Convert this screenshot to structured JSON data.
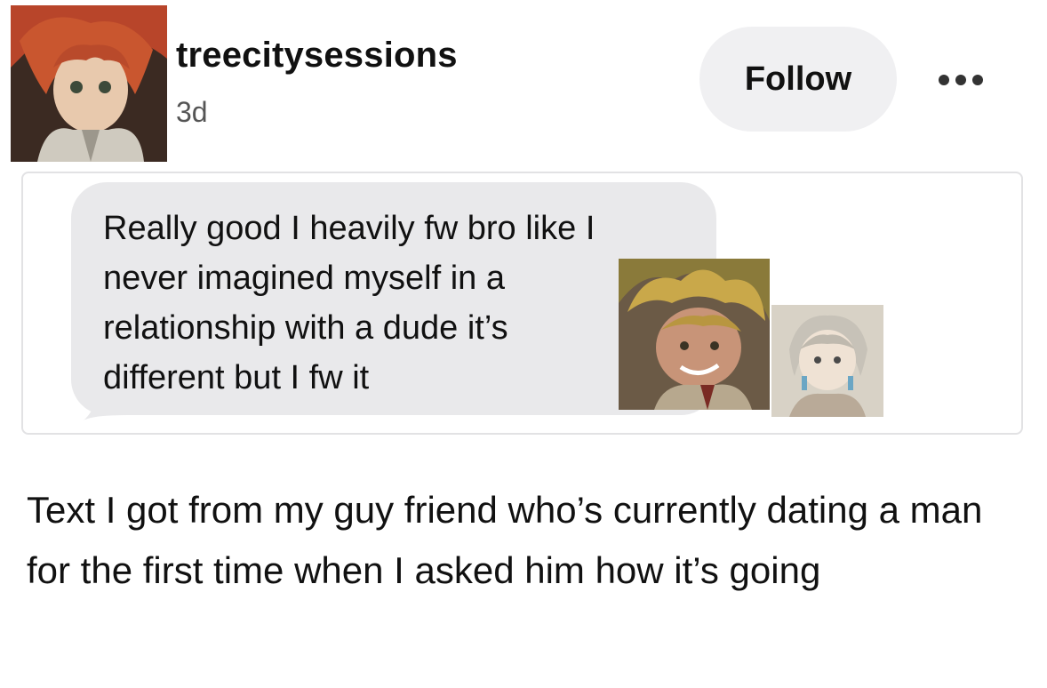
{
  "post": {
    "username": "treecitysessions",
    "timestamp": "3d",
    "follow_label": "Follow",
    "more_icon": "ellipsis-icon",
    "avatar_icon": "avatar-image",
    "embed": {
      "message_text": "Really good I heavily fw bro like I never imagined myself in a relationship with a dude it’s different but I fw it",
      "sticker_large": "anime-character-sticker",
      "sticker_small": "anime-character-sticker"
    },
    "caption": "Text I got from my guy friend who’s currently dating a man for the first time when I asked him how it’s going"
  },
  "colors": {
    "follow_bg": "#f0f0f2",
    "bubble_bg": "#e9e9eb",
    "card_border": "#e2e2e4"
  }
}
